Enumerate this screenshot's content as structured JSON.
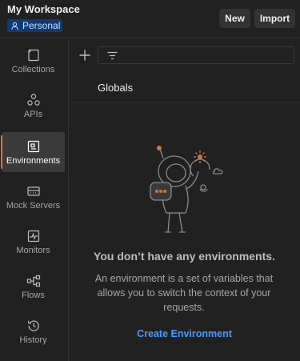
{
  "header": {
    "workspace_title": "My Workspace",
    "workspace_type": "Personal",
    "new_label": "New",
    "import_label": "Import"
  },
  "sidebar": {
    "items": [
      {
        "label": "Collections",
        "icon": "collections-icon"
      },
      {
        "label": "APIs",
        "icon": "apis-icon"
      },
      {
        "label": "Environments",
        "icon": "environments-icon",
        "active": true
      },
      {
        "label": "Mock Servers",
        "icon": "mock-servers-icon"
      },
      {
        "label": "Monitors",
        "icon": "monitors-icon"
      },
      {
        "label": "Flows",
        "icon": "flows-icon"
      },
      {
        "label": "History",
        "icon": "history-icon"
      }
    ]
  },
  "main": {
    "globals_label": "Globals",
    "empty_title": "You don’t have any environments.",
    "empty_description": "An environment is a set of variables that allows you to switch the context of your requests.",
    "create_label": "Create Environment"
  },
  "colors": {
    "accent": "#ff6c37",
    "link": "#4c9aff",
    "badge_bg": "#0f3a73",
    "background": "#212121"
  }
}
